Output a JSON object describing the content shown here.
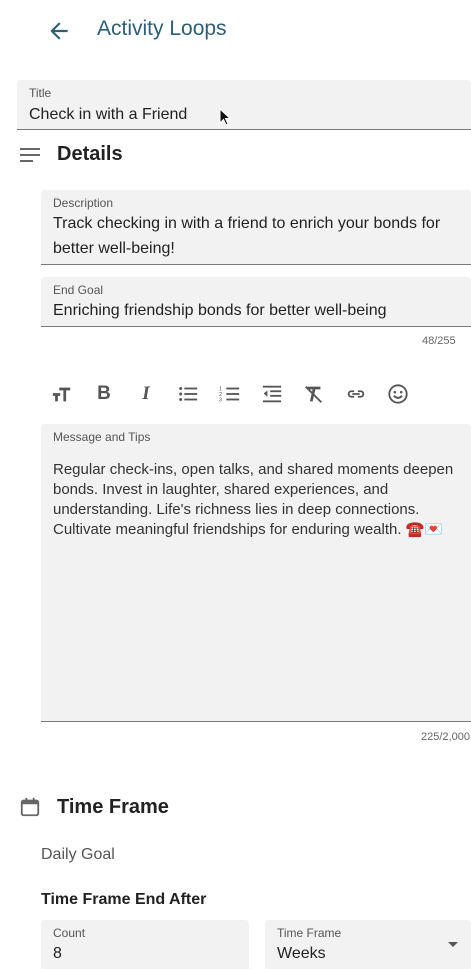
{
  "header": {
    "title": "Activity Loops",
    "back_icon": "arrow-left-icon"
  },
  "title_field": {
    "label": "Title",
    "value": "Check in with a Friend"
  },
  "details": {
    "heading": "Details",
    "description": {
      "label": "Description",
      "value": "Track checking in with a friend to enrich your bonds for better well-being!"
    },
    "end_goal": {
      "label": "End Goal",
      "value": "Enriching friendship bonds for better well-being",
      "counter": "48/255"
    }
  },
  "toolbar": {
    "items": [
      "text-size-icon",
      "bold-icon",
      "italic-icon",
      "bullet-list-icon",
      "numbered-list-icon",
      "outdent-icon",
      "clear-format-icon",
      "link-icon",
      "emoji-icon"
    ]
  },
  "message": {
    "label": "Message and Tips",
    "value": "Regular check-ins, open talks, and shared moments deepen bonds. Invest in laughter, shared experiences, and understanding. Life's richness lies in deep connections. Cultivate meaningful friendships for enduring wealth. ☎️💌",
    "counter": "225/2,000"
  },
  "time_frame": {
    "heading": "Time Frame",
    "daily_goal": "Daily Goal",
    "end_after_heading": "Time Frame End After",
    "count": {
      "label": "Count",
      "value": "8"
    },
    "frame": {
      "label": "Time Frame",
      "value": "Weeks"
    }
  },
  "colors": {
    "accent": "#2e5e73",
    "field_bg": "#f2f2f3"
  }
}
